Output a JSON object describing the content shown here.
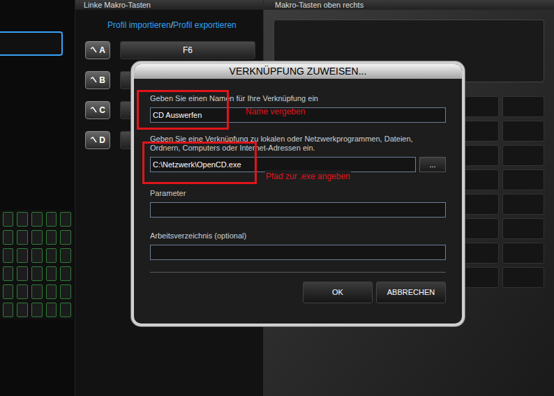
{
  "background": {
    "left_header": "Linke Makro-Tasten",
    "right_header": "Makro-Tasten oben rechts",
    "profile_links": {
      "import": "Profil importieren",
      "separator": "/",
      "export": "Profil exportieren"
    },
    "macro_keys": [
      {
        "label": "A",
        "value": "F6"
      },
      {
        "label": "B",
        "value": ""
      },
      {
        "label": "C",
        "value": ""
      },
      {
        "label": "D",
        "value": ""
      }
    ]
  },
  "dialog": {
    "title": "VERKNÜPFUNG ZUWEISEN...",
    "fields": [
      {
        "kind": "text",
        "label": "Geben Sie einen Namen für Ihre Verknüpfung ein",
        "value": "CD Auswerfen"
      },
      {
        "kind": "path",
        "label": "Geben Sie eine Verknüpfung zu lokalen oder Netzwerkprogrammen, Dateien, Ordnern, Computers oder Internet-Adressen ein.",
        "value": "C:\\Netzwerk\\OpenCD.exe",
        "browse": "..."
      },
      {
        "kind": "text",
        "label": "Parameter",
        "value": ""
      },
      {
        "kind": "text",
        "label": "Arbeitsverzeichnis (optional)",
        "value": ""
      }
    ],
    "buttons": [
      "OK",
      "ABBRECHEN"
    ]
  },
  "annotations": [
    {
      "text": "Name vergeben"
    },
    {
      "text": "Pfad zur .exe angeben"
    }
  ]
}
